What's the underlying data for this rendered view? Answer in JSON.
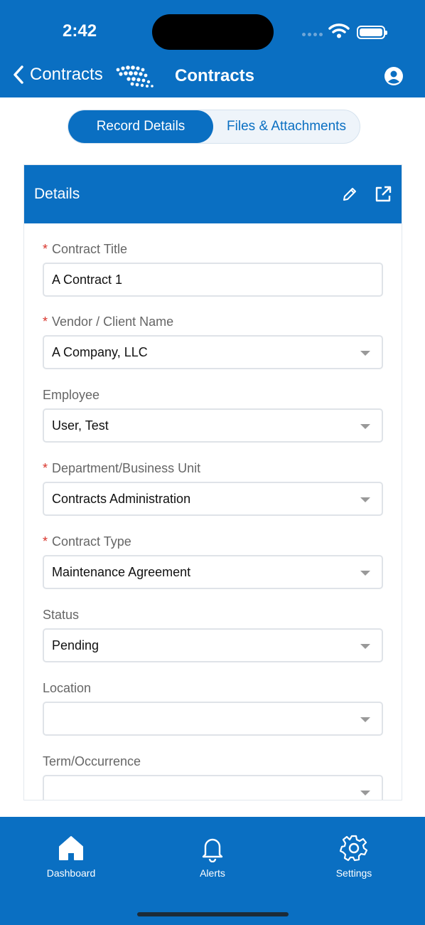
{
  "status_bar": {
    "time": "2:42"
  },
  "nav": {
    "back_label": "Contracts",
    "title": "Contracts"
  },
  "segments": {
    "active": "Record Details",
    "inactive": "Files & Attachments"
  },
  "details": {
    "title": "Details",
    "fields": [
      {
        "label": "Contract Title",
        "required": "*",
        "value": "A Contract 1"
      },
      {
        "label": "Vendor / Client Name",
        "required": "*",
        "value": "A Company, LLC"
      },
      {
        "label": "Employee",
        "required": "",
        "value": "User, Test"
      },
      {
        "label": "Department/Business Unit",
        "required": "*",
        "value": "Contracts Administration"
      },
      {
        "label": "Contract Type",
        "required": "*",
        "value": "Maintenance Agreement"
      },
      {
        "label": "Status",
        "required": "",
        "value": "Pending"
      },
      {
        "label": "Location",
        "required": "",
        "value": ""
      },
      {
        "label": "Term/Occurrence",
        "required": "",
        "value": ""
      }
    ]
  },
  "tabbar": {
    "dashboard": "Dashboard",
    "alerts": "Alerts",
    "settings": "Settings"
  },
  "colors": {
    "brand": "#0a6fc2",
    "required": "#d9342b"
  }
}
